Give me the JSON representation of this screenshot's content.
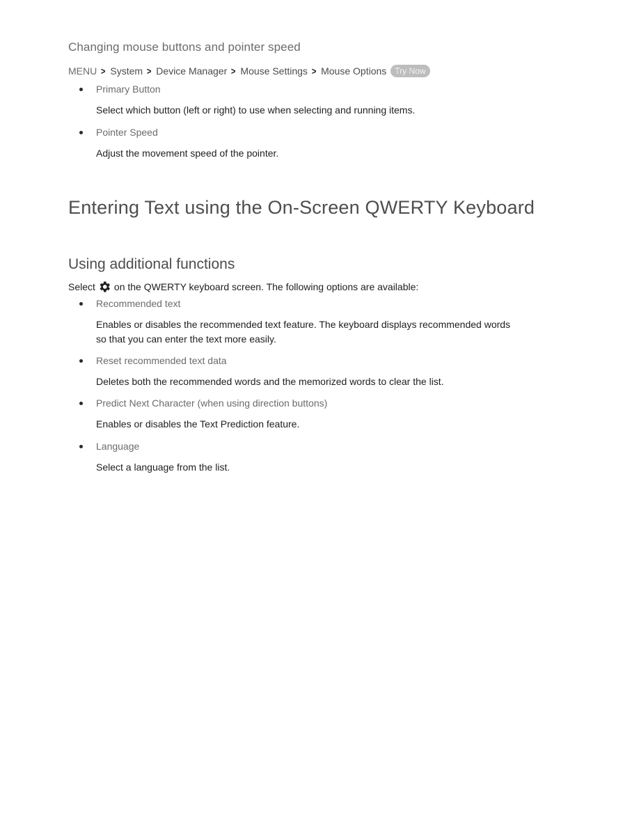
{
  "section1": {
    "heading": "Changing mouse buttons and pointer speed",
    "breadcrumb": [
      "MENU",
      "System",
      "Device Manager",
      "Mouse Settings",
      "Mouse Options"
    ],
    "breadcrumb_separator_icon": "chevron-right-icon",
    "try_now_label": "Try Now",
    "items": [
      {
        "label": "Primary Button",
        "description": "Select which button (left or right) to use when selecting and running items."
      },
      {
        "label": "Pointer Speed",
        "description": "Adjust the movement speed of the pointer."
      }
    ]
  },
  "main_heading": "Entering Text using the On-Screen QWERTY Keyboard",
  "section2": {
    "heading": "Using additional functions",
    "intro_before": "Select",
    "intro_icon": "gear-icon",
    "intro_after": "on the QWERTY keyboard screen. The following options are available:",
    "items": [
      {
        "label": "Recommended text",
        "description_line1": "Enables or disables the recommended text feature. The keyboard displays recommended words",
        "description_line2": "so that you can enter the text more easily."
      },
      {
        "label": "Reset recommended text data",
        "description": "Deletes both the recommended words and the memorized words to clear the list."
      },
      {
        "label": "Predict Next Character (when using direction buttons)",
        "description": "Enables or disables the Text Prediction feature."
      },
      {
        "label": "Language",
        "description": "Select a language from the list."
      }
    ]
  }
}
